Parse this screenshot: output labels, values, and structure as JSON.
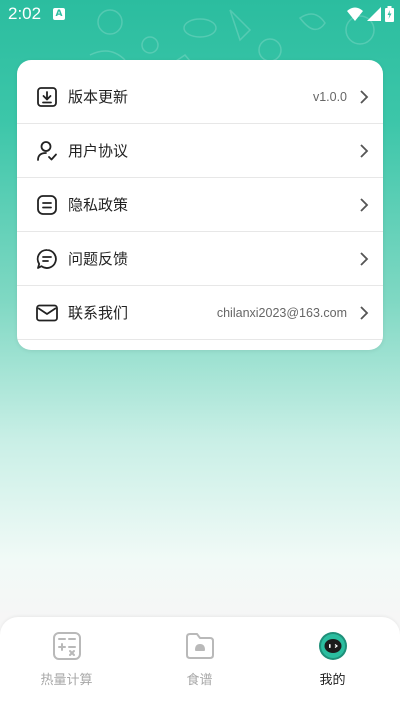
{
  "status_bar": {
    "time": "2:02",
    "notification_letter": "A"
  },
  "settings": {
    "items": [
      {
        "label": "版本更新",
        "value": "v1.0.0",
        "icon": "download-icon"
      },
      {
        "label": "用户协议",
        "value": "",
        "icon": "user-check-icon"
      },
      {
        "label": "隐私政策",
        "value": "",
        "icon": "document-icon"
      },
      {
        "label": "问题反馈",
        "value": "",
        "icon": "feedback-chat-icon"
      },
      {
        "label": "联系我们",
        "value": "chilanxi2023@163.com",
        "icon": "mail-icon"
      }
    ]
  },
  "tabbar": {
    "tabs": [
      {
        "label": "热量计算",
        "icon": "calculator-icon",
        "active": false
      },
      {
        "label": "食谱",
        "icon": "recipe-folder-icon",
        "active": false
      },
      {
        "label": "我的",
        "icon": "face-icon",
        "active": true
      }
    ]
  },
  "colors": {
    "brand": "#2bbd9f",
    "active_tab_circle": "#2bbd9f",
    "inactive_icon": "#b9b9b9"
  }
}
